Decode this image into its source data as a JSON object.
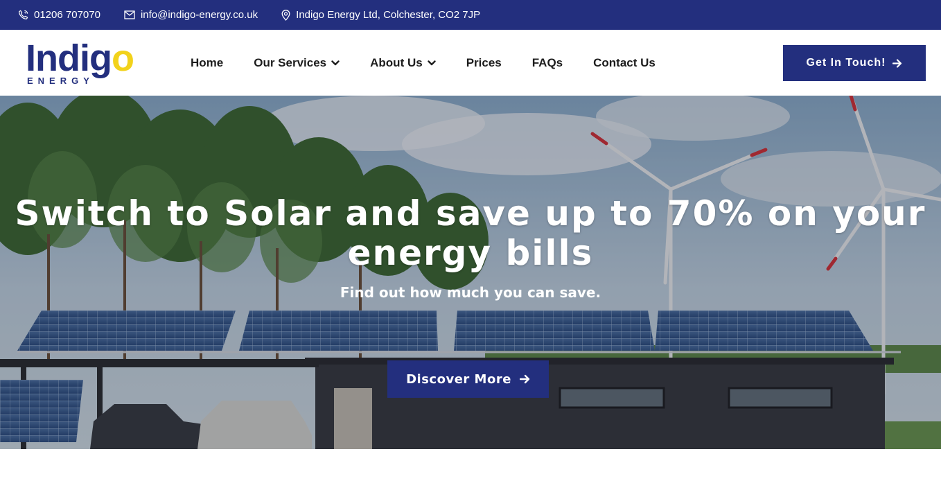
{
  "topbar": {
    "phone": "01206 707070",
    "email": "info@indigo-energy.co.uk",
    "address": "Indigo Energy Ltd, Colchester, CO2 7JP",
    "icons": [
      "phone-icon",
      "envelope-icon",
      "map-pin-icon"
    ]
  },
  "logo": {
    "word_main": "Indig",
    "word_accent": "o",
    "subtitle": "ENERGY"
  },
  "nav": {
    "items": [
      {
        "label": "Home",
        "dropdown": false
      },
      {
        "label": "Our Services",
        "dropdown": true
      },
      {
        "label": "About Us",
        "dropdown": true
      },
      {
        "label": "Prices",
        "dropdown": false
      },
      {
        "label": "FAQs",
        "dropdown": false
      },
      {
        "label": "Contact Us",
        "dropdown": false
      }
    ],
    "cta": "Get In Touch!"
  },
  "hero": {
    "title": "Switch to Solar and save up to 70% on your energy bills",
    "subtitle": "Find out how much you can save.",
    "button": "Discover More"
  },
  "colors": {
    "brand_navy": "#232f7e",
    "brand_yellow": "#f2d21b",
    "text_dark": "#1d1d1d",
    "white": "#ffffff"
  }
}
